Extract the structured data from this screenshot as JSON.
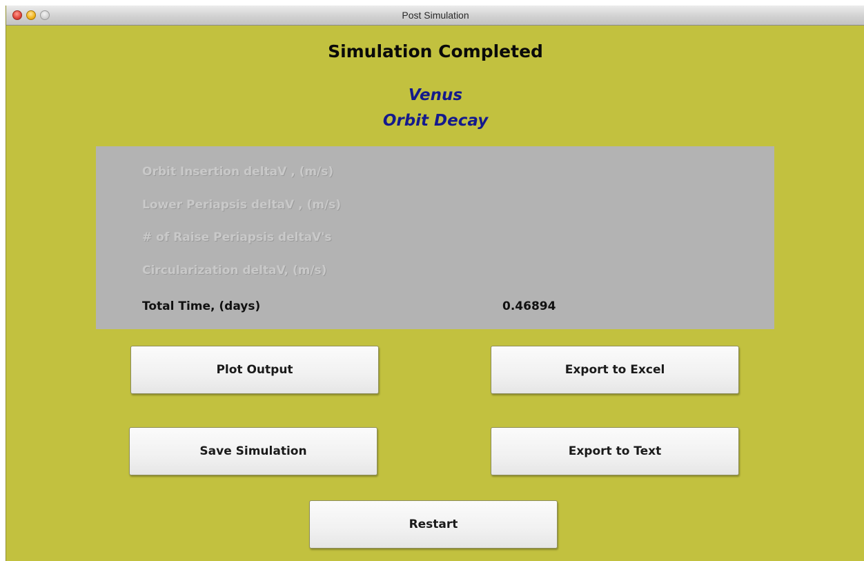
{
  "window": {
    "title": "Post Simulation"
  },
  "heading": "Simulation Completed",
  "planet": "Venus",
  "mode": "Orbit Decay",
  "results": {
    "rows": [
      {
        "label": "Orbit Insertion deltaV , (m/s)",
        "enabled": false
      },
      {
        "label": "Lower Periapsis deltaV , (m/s)",
        "enabled": false
      },
      {
        "label": "# of Raise Periapsis deltaV's",
        "enabled": false
      },
      {
        "label": "Circularization deltaV, (m/s)",
        "enabled": false
      },
      {
        "label": "Total Time, (days)",
        "enabled": true,
        "value": "0.46894"
      }
    ]
  },
  "buttons": {
    "plot_output": "Plot Output",
    "export_excel": "Export to Excel",
    "save_simulation": "Save Simulation",
    "export_text": "Export to Text",
    "restart": "Restart"
  },
  "colors": {
    "background": "#c2c13f",
    "panel": "#b3b3b3",
    "subtitle": "#141a8c"
  }
}
